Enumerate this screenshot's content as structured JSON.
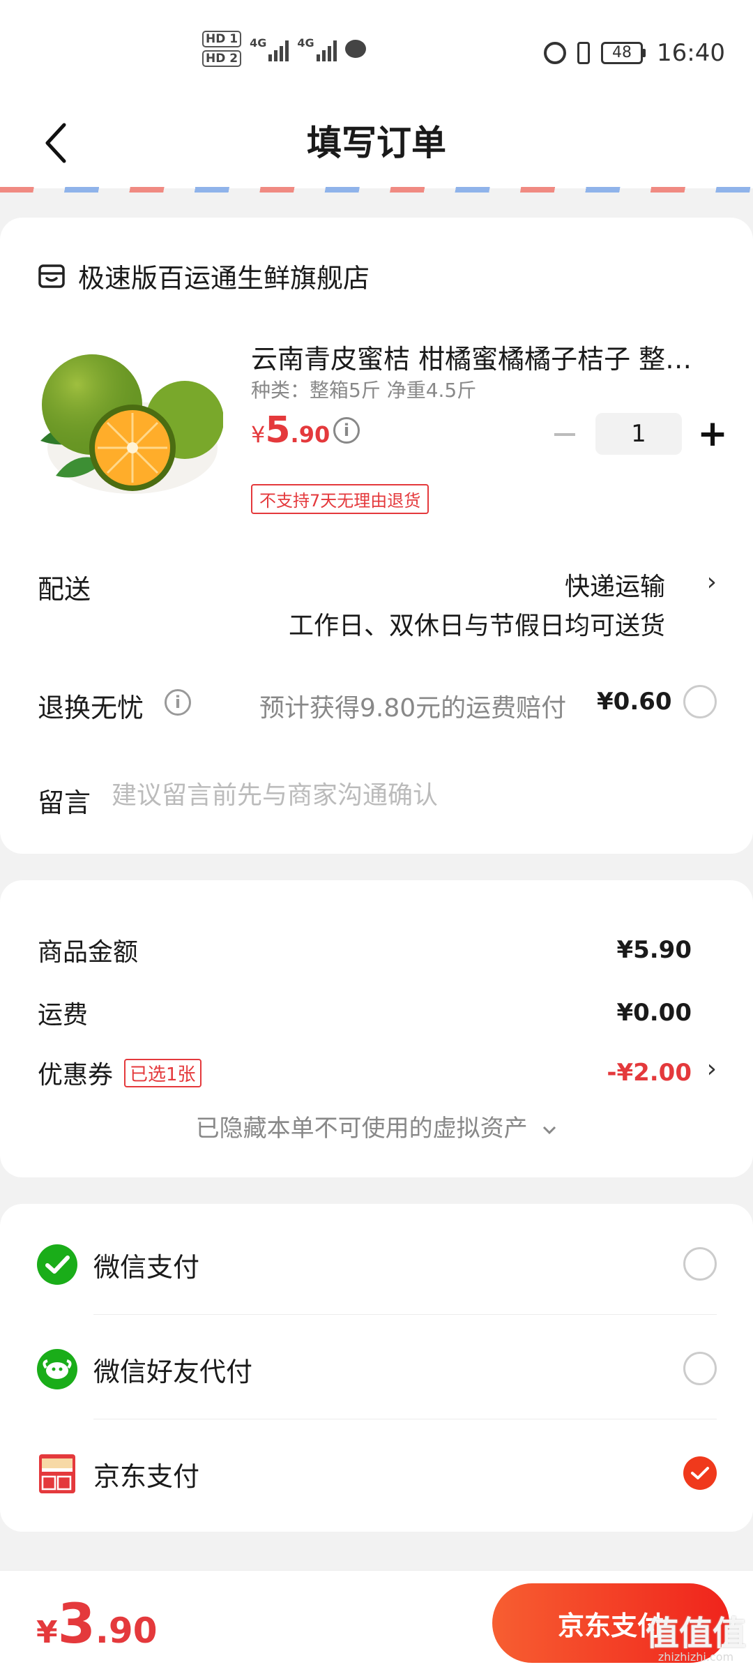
{
  "status_bar": {
    "hd1": "HD 1",
    "hd2": "HD 2",
    "net1": "4G",
    "net2": "4G",
    "battery": "48",
    "time": "16:40"
  },
  "header": {
    "title": "填写订单"
  },
  "store": {
    "name": "极速版百运通生鲜旗舰店"
  },
  "product": {
    "title": "云南青皮蜜桔 柑橘蜜橘橘子桔子 整…",
    "spec": "种类：整箱5斤 净重4.5斤",
    "price_symbol": "¥",
    "price_int": "5",
    "price_dec": ".90",
    "quantity": "1",
    "minus": "−",
    "plus": "+",
    "return_tag": "不支持7天无理由退货"
  },
  "delivery": {
    "label": "配送",
    "value": "快递运输",
    "description": "工作日、双休日与节假日均可送货"
  },
  "return_service": {
    "label": "退换无忧",
    "description": "预计获得9.80元的运费赔付",
    "price": "¥0.60"
  },
  "message": {
    "label": "留言",
    "placeholder": "建议留言前先与商家沟通确认"
  },
  "summary": {
    "goods_label": "商品金额",
    "goods_value": "¥5.90",
    "shipping_label": "运费",
    "shipping_value": "¥0.00",
    "coupon_label": "优惠券",
    "coupon_tag": "已选1张",
    "coupon_value": "-¥2.00",
    "hidden_assets": "已隐藏本单不可使用的虚拟资产"
  },
  "payment": {
    "methods": [
      {
        "label": "微信支付",
        "icon": "wechat-pay-icon",
        "selected": false
      },
      {
        "label": "微信好友代付",
        "icon": "wechat-friend-pay-icon",
        "selected": false
      },
      {
        "label": "京东支付",
        "icon": "jd-pay-icon",
        "selected": true
      }
    ]
  },
  "footer": {
    "total_symbol": "¥",
    "total_int": "3",
    "total_dec": ".90",
    "pay_button": "京东支付",
    "watermark": "值值值",
    "watermark_url": "zhizhizhi.com"
  },
  "colors": {
    "accent": "#e4393c",
    "pay_button": "#f0391c",
    "wechat_green": "#1aad19"
  }
}
